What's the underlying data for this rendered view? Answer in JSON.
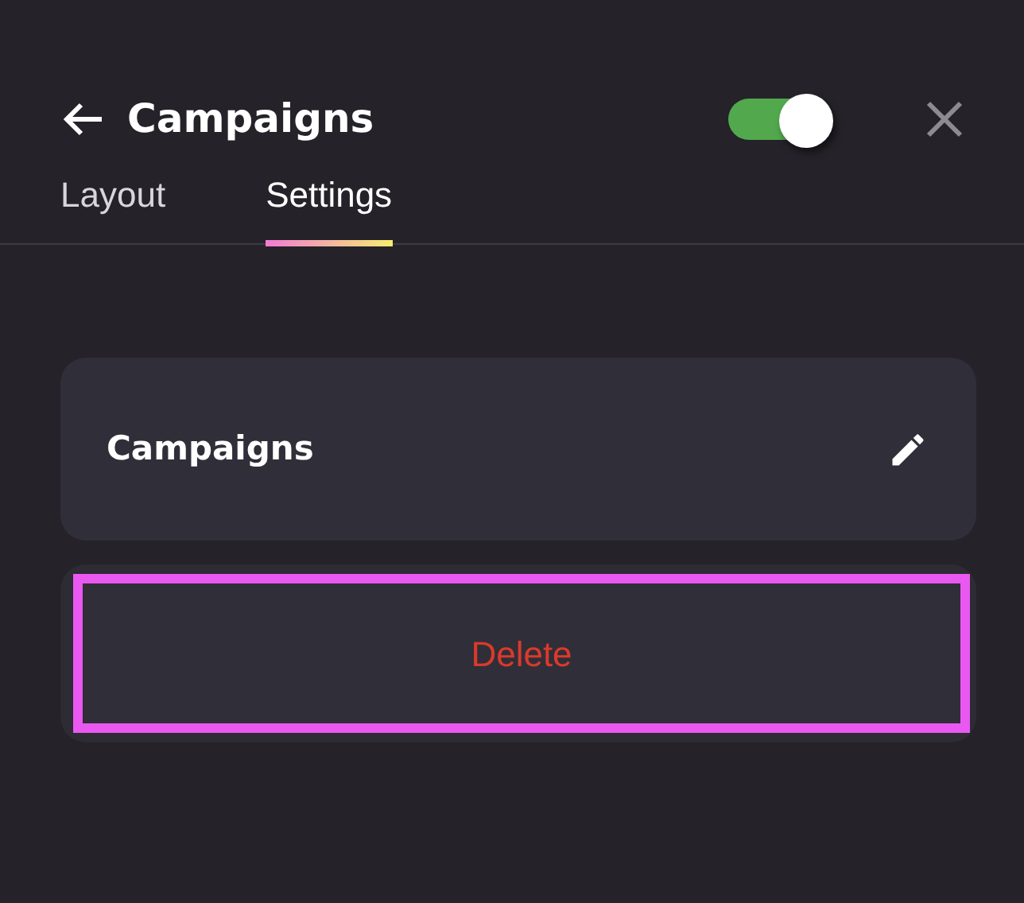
{
  "header": {
    "title": "Campaigns",
    "toggle": {
      "on": true
    }
  },
  "tabs": [
    {
      "label": "Layout",
      "selected": false
    },
    {
      "label": "Settings",
      "selected": true
    }
  ],
  "card": {
    "title": "Campaigns"
  },
  "delete_button": {
    "label": "Delete",
    "highlighted": true
  }
}
